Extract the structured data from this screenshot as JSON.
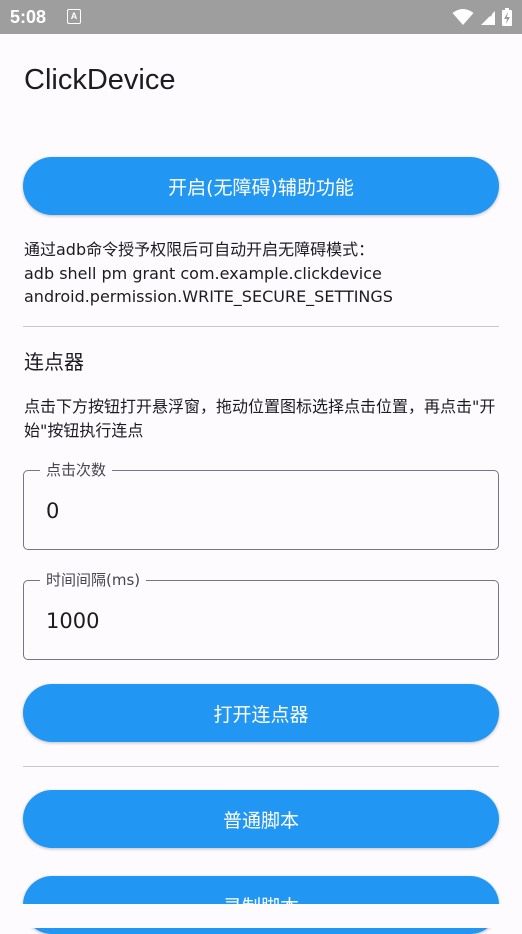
{
  "status_bar": {
    "time": "5:08",
    "notification_icon": "A",
    "icons": [
      "wifi-icon",
      "signal-icon",
      "battery-charging-icon"
    ]
  },
  "app": {
    "title": "ClickDevice"
  },
  "accessibility_button": {
    "label": "开启(无障碍)辅助功能"
  },
  "adb_info": {
    "line1": "通过adb命令授予权限后可自动开启无障碍模式：",
    "line2": "adb shell pm grant com.example.clickdevice",
    "line3": "android.permission.WRITE_SECURE_SETTINGS"
  },
  "clicker": {
    "section_title": "连点器",
    "description": "点击下方按钮打开悬浮窗，拖动位置图标选择点击位置，再点击\"开始\"按钮执行连点",
    "click_count": {
      "label": "点击次数",
      "value": "0"
    },
    "interval": {
      "label": "时间间隔(ms)",
      "value": "1000"
    },
    "open_button_label": "打开连点器"
  },
  "scripts": {
    "normal_script_label": "普通脚本",
    "record_script_label": "录制脚本"
  },
  "colors": {
    "accent": "#2196f3",
    "background": "#fefbff",
    "status_bar": "#9e9e9e",
    "outline": "#79747e"
  }
}
